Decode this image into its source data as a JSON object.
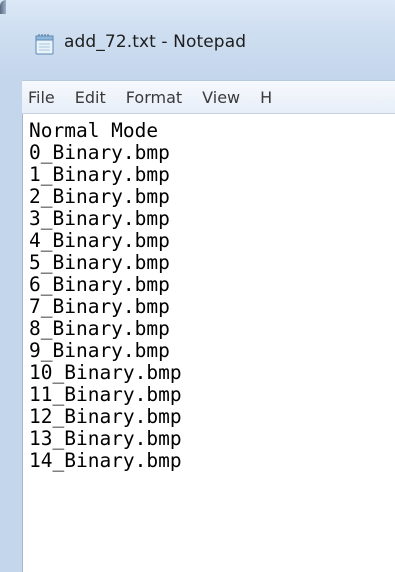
{
  "window": {
    "title": "add_72.txt - Notepad"
  },
  "icons": {
    "app_icon": "notepad-icon"
  },
  "menu": {
    "items": [
      {
        "label": "File"
      },
      {
        "label": "Edit"
      },
      {
        "label": "Format"
      },
      {
        "label": "View"
      },
      {
        "label": "H"
      }
    ]
  },
  "document": {
    "lines": [
      "Normal Mode",
      "0_Binary.bmp",
      "1_Binary.bmp",
      "2_Binary.bmp",
      "3_Binary.bmp",
      "4_Binary.bmp",
      "5_Binary.bmp",
      "6_Binary.bmp",
      "7_Binary.bmp",
      "8_Binary.bmp",
      "9_Binary.bmp",
      "10_Binary.bmp",
      "11_Binary.bmp",
      "12_Binary.bmp",
      "13_Binary.bmp",
      "14_Binary.bmp"
    ]
  }
}
